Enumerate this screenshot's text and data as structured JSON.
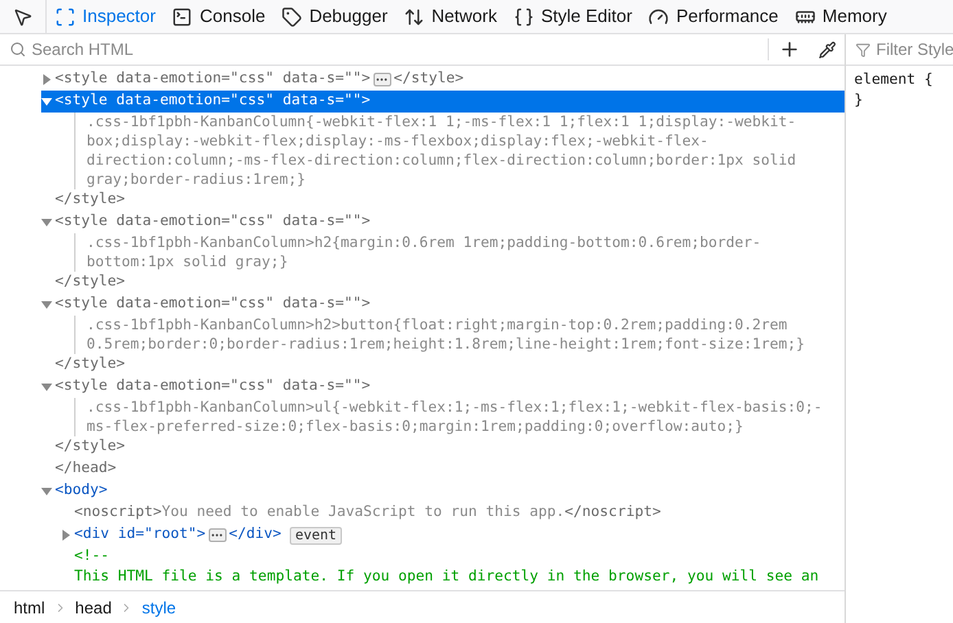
{
  "toolbar": {
    "tabs": [
      {
        "label": "Inspector",
        "selected": true
      },
      {
        "label": "Console",
        "selected": false
      },
      {
        "label": "Debugger",
        "selected": false
      },
      {
        "label": "Network",
        "selected": false
      },
      {
        "label": "Style Editor",
        "selected": false
      },
      {
        "label": "Performance",
        "selected": false
      },
      {
        "label": "Memory",
        "selected": false
      }
    ]
  },
  "search": {
    "placeholder": "Search HTML"
  },
  "markup": [
    {
      "kind": "element",
      "open": "<style data-emotion=\"css\" data-s=\"\">",
      "close": "</style>",
      "expanded": false,
      "selected": false,
      "dimmed": true
    },
    {
      "kind": "element",
      "open": "<style data-emotion=\"css\" data-s=\"\">",
      "close": "</style>",
      "expanded": true,
      "selected": true,
      "dimmed": true,
      "children": [
        {
          "kind": "text",
          "text": ".css-1bf1pbh-KanbanColumn{-webkit-flex:1 1;-ms-flex:1 1;flex:1 1;display:-webkit-box;display:-webkit-flex;display:-ms-flexbox;display:flex;-webkit-flex-direction:column;-ms-flex-direction:column;flex-direction:column;border:1px solid gray;border-radius:1rem;}"
        }
      ]
    },
    {
      "kind": "element",
      "open": "<style data-emotion=\"css\" data-s=\"\">",
      "close": "</style>",
      "expanded": true,
      "selected": false,
      "dimmed": true,
      "children": [
        {
          "kind": "text",
          "text": ".css-1bf1pbh-KanbanColumn>h2{margin:0.6rem 1rem;padding-bottom:0.6rem;border-bottom:1px solid gray;}"
        }
      ]
    },
    {
      "kind": "element",
      "open": "<style data-emotion=\"css\" data-s=\"\">",
      "close": "</style>",
      "expanded": true,
      "selected": false,
      "dimmed": true,
      "children": [
        {
          "kind": "text",
          "text": ".css-1bf1pbh-KanbanColumn>h2>button{float:right;margin-top:0.2rem;padding:0.2rem 0.5rem;border:0;border-radius:1rem;height:1.8rem;line-height:1rem;font-size:1rem;}"
        }
      ]
    },
    {
      "kind": "element",
      "open": "<style data-emotion=\"css\" data-s=\"\">",
      "close": "</style>",
      "expanded": true,
      "selected": false,
      "dimmed": true,
      "children": [
        {
          "kind": "text",
          "text": ".css-1bf1pbh-KanbanColumn>ul{-webkit-flex:1;-ms-flex:1;flex:1;-webkit-flex-basis:0;-ms-flex-preferred-size:0;flex-basis:0;margin:1rem;padding:0;overflow:auto;}"
        }
      ]
    },
    {
      "kind": "closing",
      "close": "</head>"
    },
    {
      "kind": "element",
      "open": "<body>",
      "expanded": true,
      "selected": false,
      "dimmed": false,
      "children": [
        {
          "kind": "inline",
          "open": "<noscript>",
          "text": "You need to enable JavaScript to run this app.",
          "close": "</noscript>"
        },
        {
          "kind": "element",
          "open": "<div id=\"root\">",
          "close": "</div>",
          "badge": "event",
          "expanded": false,
          "selected": false,
          "dimmed": false
        },
        {
          "kind": "comment",
          "open": "<!--",
          "text": "This HTML file is a template. If you open it directly in the browser, you will see an"
        }
      ]
    }
  ],
  "rules": {
    "placeholder": "Filter Style",
    "selector": "element {",
    "close": "}"
  },
  "breadcrumbs": [
    {
      "label": "html",
      "selected": false
    },
    {
      "label": "head",
      "selected": false
    },
    {
      "label": "style",
      "selected": true
    }
  ]
}
